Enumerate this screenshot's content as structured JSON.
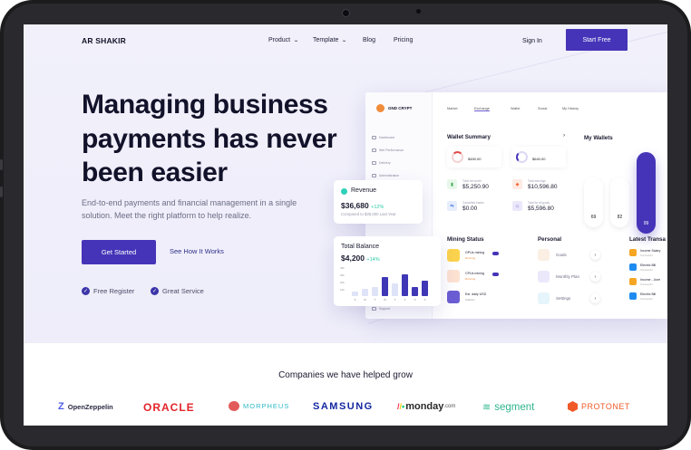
{
  "nav": {
    "logo": "AR SHAKIR",
    "product": "Product",
    "template": "Template",
    "blog": "Blog",
    "pricing": "Pricing",
    "sign_in": "Sign In",
    "start_free": "Start Free"
  },
  "hero": {
    "headline_1": "Managing business",
    "headline_2": "payments has never",
    "headline_3": "been easier",
    "subtext": "End-to-end payments and financial management in a single solution. Meet the right platform to help realize.",
    "cta_primary": "Get Started",
    "cta_secondary": "See How It Works",
    "checks": [
      "Free Register",
      "Great Service"
    ]
  },
  "dashboard": {
    "brand": "GND CRYPT",
    "tabs": [
      "Market",
      "Exchange",
      "Wallet",
      "Social",
      "My History"
    ],
    "sidebar": [
      "Dashboard",
      "Wet Performance",
      "Delivery",
      "Administration",
      "Support"
    ],
    "wallet_summary": {
      "title": "Wallet Summary",
      "cards": [
        "$450.00",
        "$640.00"
      ],
      "stats": [
        {
          "label": "Total net worth",
          "value": "$5,250.90"
        },
        {
          "label": "Total earnings",
          "value": "$10,596.80"
        },
        {
          "label": "Cancelled banks",
          "value": "$0.00"
        },
        {
          "label": "Total for all goals",
          "value": "$5,596.80"
        }
      ]
    },
    "my_wallets": {
      "title": "My Wallets",
      "values": [
        "69",
        "82",
        "99"
      ]
    },
    "mining": {
      "title": "Mining Status",
      "items": [
        {
          "label": "GPUs mining",
          "sub": "Running"
        },
        {
          "label": "CPUs mining",
          "sub": "Running"
        },
        {
          "label": "Est. daily USD",
          "sub": "Statistic"
        }
      ]
    },
    "personal": {
      "title": "Personal",
      "items": [
        "Goals",
        "Monthly Plan",
        "Settings"
      ]
    },
    "transactions": {
      "title": "Latest Transa",
      "items": [
        {
          "label": "Income Salary",
          "sub": "Successful"
        },
        {
          "label": "Electric Bill",
          "sub": "Successful"
        },
        {
          "label": "Income - June",
          "sub": "Successful"
        },
        {
          "label": "Electric Bill",
          "sub": "Successful"
        }
      ]
    },
    "arrow": "›"
  },
  "revenue_card": {
    "title": "Revenue",
    "value": "$36,680",
    "change": "+12%",
    "sub": "Compared to $35,000 Last Year"
  },
  "balance_card": {
    "title": "Total Balance",
    "value": "$4,200",
    "change": "+14%",
    "yticks": [
      "40k",
      "30k",
      "20k",
      "10k"
    ],
    "days": [
      "S",
      "M",
      "T",
      "W",
      "T",
      "F",
      "S",
      "S"
    ],
    "values": [
      6,
      9,
      12,
      24,
      16,
      28,
      12,
      20
    ],
    "colors": {
      "dim": "#dfe3f7",
      "strong": "#3f37b6"
    }
  },
  "companies": {
    "title": "Companies we have helped grow",
    "logos": [
      "OpenZeppelin",
      "ORACLE",
      "MORPHEUS",
      "SAMSUNG",
      "monday",
      "segment",
      "PROTONET"
    ],
    "monday_suffix": ".com",
    "colors": {
      "openzeppelin": "#4e5ee4",
      "oracle": "#e3242b",
      "morpheus": "#2eb8c7",
      "samsung": "#1428a0",
      "monday": "#2a2a2a",
      "segment": "#2fb58e",
      "protonet": "#f05a28"
    }
  },
  "icons": {
    "check": "check-icon",
    "chevron": "chevron-down-icon"
  }
}
